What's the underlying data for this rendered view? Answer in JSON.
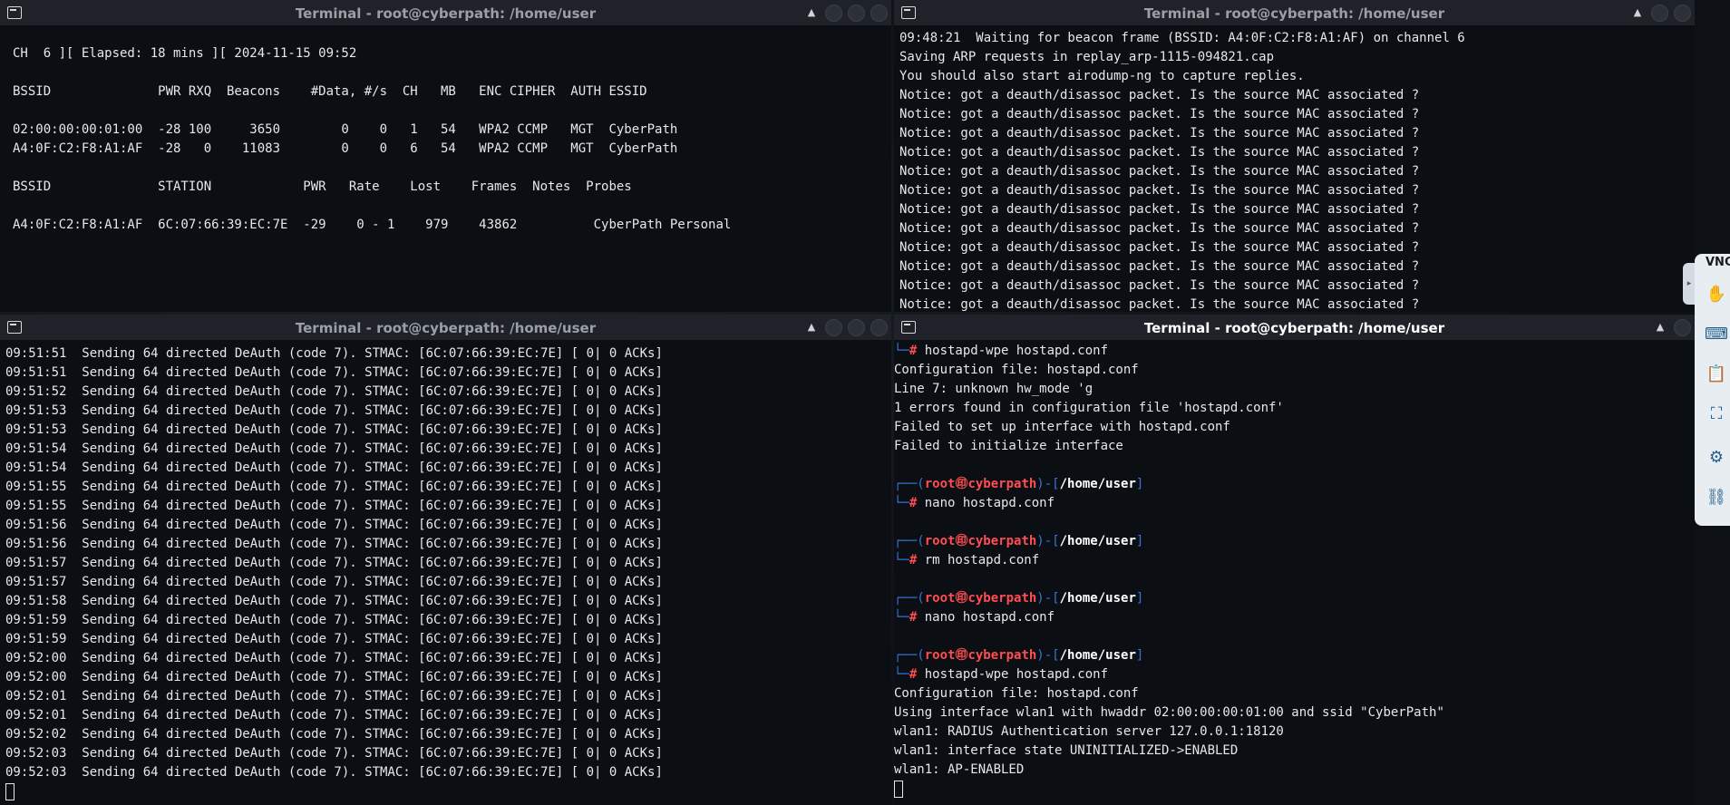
{
  "windows": {
    "top_left": {
      "title": "Terminal - root@cyberpath: /home/user",
      "lines": [
        "",
        "CH  6 ][ Elapsed: 18 mins ][ 2024-11-15 09:52",
        "",
        "BSSID              PWR RXQ  Beacons    #Data, #/s  CH   MB   ENC CIPHER  AUTH ESSID",
        "",
        "02:00:00:00:01:00  -28 100     3650        0    0   1   54   WPA2 CCMP   MGT  CyberPath",
        "A4:0F:C2:F8:A1:AF  -28   0    11083        0    0   6   54   WPA2 CCMP   MGT  CyberPath",
        "",
        "BSSID              STATION            PWR   Rate    Lost    Frames  Notes  Probes",
        "",
        "A4:0F:C2:F8:A1:AF  6C:07:66:39:EC:7E  -29    0 - 1    979    43862          CyberPath Personal"
      ]
    },
    "top_right": {
      "title": "Terminal - root@cyberpath: /home/user",
      "lines": [
        "09:48:21  Waiting for beacon frame (BSSID: A4:0F:C2:F8:A1:AF) on channel 6",
        "Saving ARP requests in replay_arp-1115-094821.cap",
        "You should also start airodump-ng to capture replies.",
        "Notice: got a deauth/disassoc packet. Is the source MAC associated ?",
        "Notice: got a deauth/disassoc packet. Is the source MAC associated ?",
        "Notice: got a deauth/disassoc packet. Is the source MAC associated ?",
        "Notice: got a deauth/disassoc packet. Is the source MAC associated ?",
        "Notice: got a deauth/disassoc packet. Is the source MAC associated ?",
        "Notice: got a deauth/disassoc packet. Is the source MAC associated ?",
        "Notice: got a deauth/disassoc packet. Is the source MAC associated ?",
        "Notice: got a deauth/disassoc packet. Is the source MAC associated ?",
        "Notice: got a deauth/disassoc packet. Is the source MAC associated ?",
        "Notice: got a deauth/disassoc packet. Is the source MAC associated ?",
        "Notice: got a deauth/disassoc packet. Is the source MAC associated ?",
        "Notice: got a deauth/disassoc packet. Is the source MAC associated ?",
        "Notice: got a deauth/disassoc packet. Is the source MAC associated ?",
        "Notice: got a deauth/disassoc packet. Is the source MAC associated ?",
        "Notice: got a deauth/disassoc packet. Is the source MAC associated ?"
      ]
    },
    "bottom_left": {
      "title": "Terminal - root@cyberpath: /home/user",
      "lines": [
        "09:51:51  Sending 64 directed DeAuth (code 7). STMAC: [6C:07:66:39:EC:7E] [ 0| 0 ACKs]",
        "09:51:51  Sending 64 directed DeAuth (code 7). STMAC: [6C:07:66:39:EC:7E] [ 0| 0 ACKs]",
        "09:51:52  Sending 64 directed DeAuth (code 7). STMAC: [6C:07:66:39:EC:7E] [ 0| 0 ACKs]",
        "09:51:53  Sending 64 directed DeAuth (code 7). STMAC: [6C:07:66:39:EC:7E] [ 0| 0 ACKs]",
        "09:51:53  Sending 64 directed DeAuth (code 7). STMAC: [6C:07:66:39:EC:7E] [ 0| 0 ACKs]",
        "09:51:54  Sending 64 directed DeAuth (code 7). STMAC: [6C:07:66:39:EC:7E] [ 0| 0 ACKs]",
        "09:51:54  Sending 64 directed DeAuth (code 7). STMAC: [6C:07:66:39:EC:7E] [ 0| 0 ACKs]",
        "09:51:55  Sending 64 directed DeAuth (code 7). STMAC: [6C:07:66:39:EC:7E] [ 0| 0 ACKs]",
        "09:51:55  Sending 64 directed DeAuth (code 7). STMAC: [6C:07:66:39:EC:7E] [ 0| 0 ACKs]",
        "09:51:56  Sending 64 directed DeAuth (code 7). STMAC: [6C:07:66:39:EC:7E] [ 0| 0 ACKs]",
        "09:51:56  Sending 64 directed DeAuth (code 7). STMAC: [6C:07:66:39:EC:7E] [ 0| 0 ACKs]",
        "09:51:57  Sending 64 directed DeAuth (code 7). STMAC: [6C:07:66:39:EC:7E] [ 0| 0 ACKs]",
        "09:51:57  Sending 64 directed DeAuth (code 7). STMAC: [6C:07:66:39:EC:7E] [ 0| 0 ACKs]",
        "09:51:58  Sending 64 directed DeAuth (code 7). STMAC: [6C:07:66:39:EC:7E] [ 0| 0 ACKs]",
        "09:51:59  Sending 64 directed DeAuth (code 7). STMAC: [6C:07:66:39:EC:7E] [ 0| 0 ACKs]",
        "09:51:59  Sending 64 directed DeAuth (code 7). STMAC: [6C:07:66:39:EC:7E] [ 0| 0 ACKs]",
        "09:52:00  Sending 64 directed DeAuth (code 7). STMAC: [6C:07:66:39:EC:7E] [ 0| 0 ACKs]",
        "09:52:00  Sending 64 directed DeAuth (code 7). STMAC: [6C:07:66:39:EC:7E] [ 0| 0 ACKs]",
        "09:52:01  Sending 64 directed DeAuth (code 7). STMAC: [6C:07:66:39:EC:7E] [ 0| 0 ACKs]",
        "09:52:01  Sending 64 directed DeAuth (code 7). STMAC: [6C:07:66:39:EC:7E] [ 0| 0 ACKs]",
        "09:52:02  Sending 64 directed DeAuth (code 7). STMAC: [6C:07:66:39:EC:7E] [ 0| 0 ACKs]",
        "09:52:03  Sending 64 directed DeAuth (code 7). STMAC: [6C:07:66:39:EC:7E] [ 0| 0 ACKs]",
        "09:52:03  Sending 64 directed DeAuth (code 7). STMAC: [6C:07:66:39:EC:7E] [ 0| 0 ACKs]"
      ]
    },
    "bottom_right": {
      "title": "Terminal - root@cyberpath: /home/user",
      "prompt": {
        "user": "root",
        "at": "㊞",
        "host": "cyberpath",
        "path": "/home/user"
      },
      "first_command": "hostapd-wpe hostapd.conf",
      "output1": [
        "Configuration file: hostapd.conf",
        "Line 7: unknown hw_mode 'g",
        "1 errors found in configuration file 'hostapd.conf'",
        "Failed to set up interface with hostapd.conf",
        "Failed to initialize interface"
      ],
      "commands": [
        "nano hostapd.conf",
        "rm hostapd.conf",
        "nano hostapd.conf",
        "hostapd-wpe hostapd.conf"
      ],
      "output2": [
        "Configuration file: hostapd.conf",
        "Using interface wlan1 with hwaddr 02:00:00:00:01:00 and ssid \"CyberPath\"",
        "wlan1: RADIUS Authentication server 127.0.0.1:18120",
        "wlan1: interface state UNINITIALIZED->ENABLED",
        "wlan1: AP-ENABLED"
      ]
    }
  },
  "vnc_panel": {
    "label": "VNC"
  }
}
